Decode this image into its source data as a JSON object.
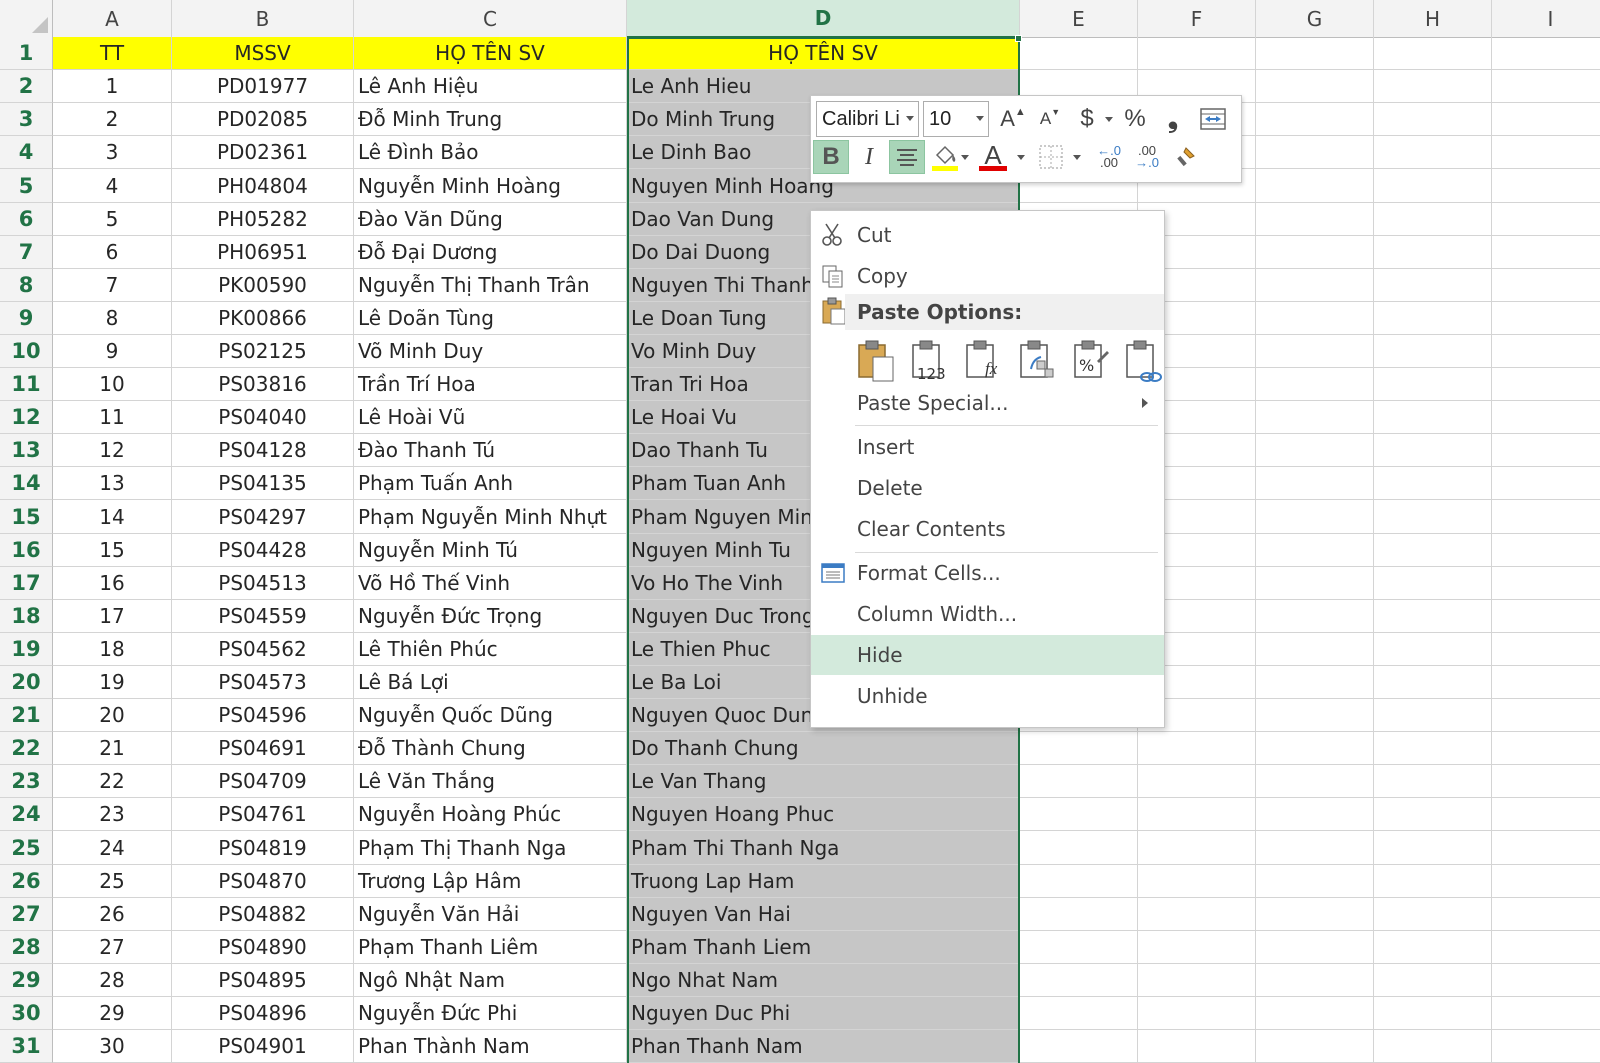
{
  "columns": [
    "A",
    "B",
    "C",
    "D",
    "E",
    "F",
    "G",
    "H",
    "I"
  ],
  "header_row": [
    "TT",
    "MSSV",
    "HỌ TÊN SV",
    "HỌ TÊN SV"
  ],
  "rows": [
    [
      "1",
      "PD01977",
      "Lê Anh Hiệu",
      "Le Anh Hieu"
    ],
    [
      "2",
      "PD02085",
      "Đỗ Minh Trung",
      "Do Minh Trung"
    ],
    [
      "3",
      "PD02361",
      "Lê Đình Bảo",
      "Le Dinh Bao"
    ],
    [
      "4",
      "PH04804",
      "Nguyễn Minh Hoàng",
      "Nguyen Minh Hoang"
    ],
    [
      "5",
      "PH05282",
      "Đào Văn Dũng",
      "Dao Van Dung"
    ],
    [
      "6",
      "PH06951",
      "Đỗ Đại Dương",
      "Do Dai Duong"
    ],
    [
      "7",
      "PK00590",
      "Nguyễn Thị Thanh Trân",
      "Nguyen Thi Thanh"
    ],
    [
      "8",
      "PK00866",
      "Lê Doãn Tùng",
      "Le Doan Tung"
    ],
    [
      "9",
      "PS02125",
      "Võ Minh Duy",
      "Vo Minh Duy"
    ],
    [
      "10",
      "PS03816",
      "Trần Trí Hoa",
      "Tran Tri Hoa"
    ],
    [
      "11",
      "PS04040",
      "Lê Hoài Vũ",
      "Le Hoai Vu"
    ],
    [
      "12",
      "PS04128",
      "Đào Thanh Tú",
      "Dao Thanh Tu"
    ],
    [
      "13",
      "PS04135",
      "Phạm Tuấn Anh",
      "Pham Tuan Anh"
    ],
    [
      "14",
      "PS04297",
      "Phạm Nguyễn Minh Nhựt",
      "Pham Nguyen Min"
    ],
    [
      "15",
      "PS04428",
      "Nguyễn Minh Tú",
      "Nguyen Minh Tu"
    ],
    [
      "16",
      "PS04513",
      "Võ Hồ Thế Vinh",
      "Vo Ho The Vinh"
    ],
    [
      "17",
      "PS04559",
      "Nguyễn Đức Trọng",
      "Nguyen Duc Trong"
    ],
    [
      "18",
      "PS04562",
      "Lê Thiên Phúc",
      "Le Thien Phuc"
    ],
    [
      "19",
      "PS04573",
      "Lê Bá Lợi",
      "Le Ba Loi"
    ],
    [
      "20",
      "PS04596",
      "Nguyễn Quốc Dũng",
      "Nguyen Quoc Dung"
    ],
    [
      "21",
      "PS04691",
      "Đỗ Thành Chung",
      "Do Thanh Chung"
    ],
    [
      "22",
      "PS04709",
      "Lê Văn Thắng",
      "Le Van Thang"
    ],
    [
      "23",
      "PS04761",
      "Nguyễn Hoàng Phúc",
      "Nguyen Hoang Phuc"
    ],
    [
      "24",
      "PS04819",
      "Phạm Thị Thanh Nga",
      "Pham Thi Thanh Nga"
    ],
    [
      "25",
      "PS04870",
      "Trương Lập Hâm",
      "Truong Lap Ham"
    ],
    [
      "26",
      "PS04882",
      "Nguyễn Văn Hải",
      "Nguyen Van Hai"
    ],
    [
      "27",
      "PS04890",
      "Phạm Thanh Liêm",
      "Pham Thanh Liem"
    ],
    [
      "28",
      "PS04895",
      "Ngô Nhật Nam",
      "Ngo Nhat Nam"
    ],
    [
      "29",
      "PS04896",
      "Nguyễn Đức Phi",
      "Nguyen Duc Phi"
    ],
    [
      "30",
      "PS04901",
      "Phan Thành Nam",
      "Phan Thanh Nam"
    ]
  ],
  "colors": {
    "header_fill": "#ffff00",
    "selected_fill": "#c6c6c6",
    "excel_green": "#217346",
    "hover_green": "#d3eadc"
  },
  "mini_toolbar": {
    "font_name": "Calibri Li",
    "font_size": "10",
    "increase_font_icon": "A",
    "decrease_font_icon": "A",
    "currency_icon": "$",
    "percent_icon": "%",
    "comma_icon": "❟",
    "bold_icon": "B",
    "italic_icon": "I",
    "font_color_icon": "A",
    "increase_decimal_icon": ".00",
    "decrease_decimal_icon": ".00"
  },
  "context_menu": {
    "cut": "Cut",
    "copy": "Copy",
    "paste_options": "Paste Options:",
    "paste_values_label": "123",
    "paste_formulas_label": "fx",
    "paste_special": "Paste Special...",
    "insert": "Insert",
    "delete": "Delete",
    "clear_contents": "Clear Contents",
    "format_cells": "Format Cells...",
    "column_width": "Column Width...",
    "hide": "Hide",
    "unhide": "Unhide"
  }
}
